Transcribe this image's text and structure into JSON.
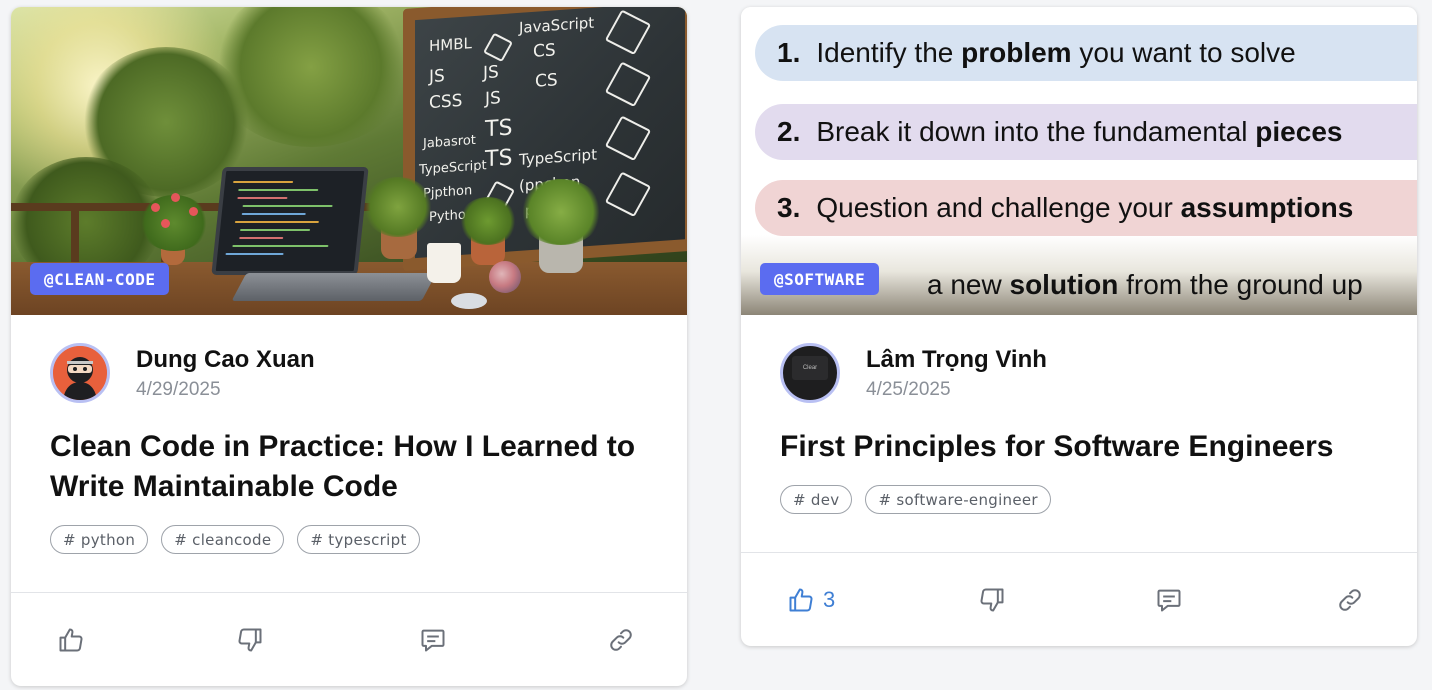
{
  "posts": [
    {
      "tag": "@CLEAN-CODE",
      "author": "Dung Cao Xuan",
      "date": "4/29/2025",
      "title": "Clean Code in Practice: How I Learned to Write Maintainable Code",
      "hashtags": [
        "# python",
        "# cleancode",
        "# typescript"
      ],
      "cover_chalk": [
        "HMBL",
        "JS",
        "CSS",
        "JavaScript",
        "CS",
        "JS",
        "CS",
        "Jabasrot",
        "TS",
        "JS",
        "TypeScript",
        "TS",
        "TypeScript",
        "Pjpthon",
        "(ppchon",
        "Python",
        "pyt"
      ],
      "likes": ""
    },
    {
      "tag": "@SOFTWARE",
      "author": "Lâm Trọng Vinh",
      "date": "4/25/2025",
      "title": "First Principles for Software Engineers",
      "hashtags": [
        "# dev",
        "# software-engineer"
      ],
      "likes": "3",
      "cover_steps": [
        {
          "num": "1.",
          "pre": "Identify the ",
          "bold": "problem",
          "post": " you want to solve"
        },
        {
          "num": "2.",
          "pre": "Break it down into the fundamental ",
          "bold": "pieces",
          "post": ""
        },
        {
          "num": "3.",
          "pre": "Question and challenge your ",
          "bold": "assumptions",
          "post": ""
        },
        {
          "num": "",
          "pre": "a new ",
          "bold": "solution",
          "post": " from the ground up"
        }
      ],
      "avatar_text": "Clear"
    }
  ],
  "icons": {
    "like": "thumbs-up-icon",
    "dislike": "thumbs-down-icon",
    "comment": "comment-icon",
    "share": "link-icon"
  },
  "colors": {
    "tag_bg": "#5b6cf0",
    "like_active": "#3f7fd4",
    "avatar_ring": "#b9c0f3"
  }
}
